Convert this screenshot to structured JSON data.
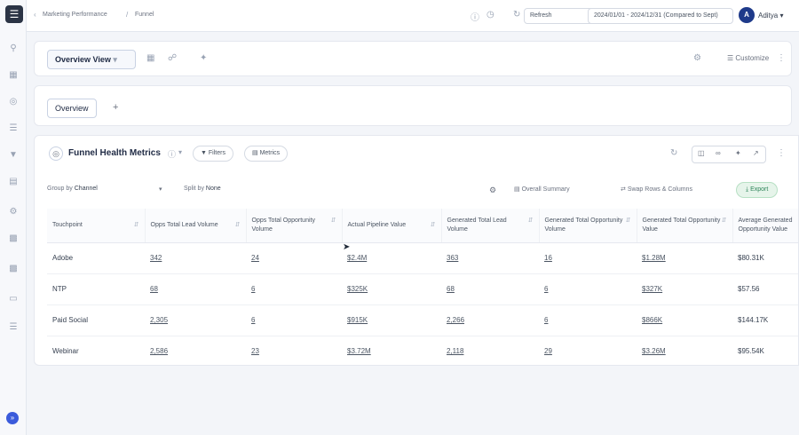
{
  "topbar": {
    "breadcrumb_app": "Marketing Performance",
    "breadcrumb_page": "Funnel",
    "refresh_label": "Refresh",
    "date_range": "2024/01/01 - 2024/12/31 (Compared to Sept)",
    "avatar_initial": "A",
    "user_name": "Aditya"
  },
  "viewbar": {
    "view_name": "Overview View",
    "customize_label": "Customize"
  },
  "tabs": {
    "overview_label": "Overview",
    "add_label": "+"
  },
  "panel": {
    "title": "Funnel Health Metrics",
    "filters_label": "Filters",
    "metrics_label": "Metrics",
    "group_by_label": "Group by",
    "group_by_value": "Channel",
    "split_by_label": "Split by",
    "split_by_value": "None",
    "overall_summary_label": "Overall Summary",
    "swap_label": "Swap Rows & Columns",
    "export_label": "Export"
  },
  "table": {
    "columns": [
      "Touchpoint",
      "Opps Total Lead Volume",
      "Opps Total Opportunity Volume",
      "Actual Pipeline Value",
      "Generated Total Lead Volume",
      "Generated Total Opportunity Volume",
      "Generated Total Opportunity Value",
      "Average Generated Opportunity Value"
    ],
    "rows": [
      [
        "Adobe",
        "342",
        "24",
        "$2.4M",
        "363",
        "16",
        "$1.28M",
        "$80.31K"
      ],
      [
        "NTP",
        "68",
        "6",
        "$325K",
        "68",
        "6",
        "$327K",
        "$57.56"
      ],
      [
        "Paid Social",
        "2,305",
        "6",
        "$915K",
        "2,266",
        "6",
        "$866K",
        "$144.17K"
      ],
      [
        "Webinar",
        "2,586",
        "23",
        "$3.72M",
        "2,118",
        "29",
        "$3.26M",
        "$95.54K"
      ]
    ]
  }
}
